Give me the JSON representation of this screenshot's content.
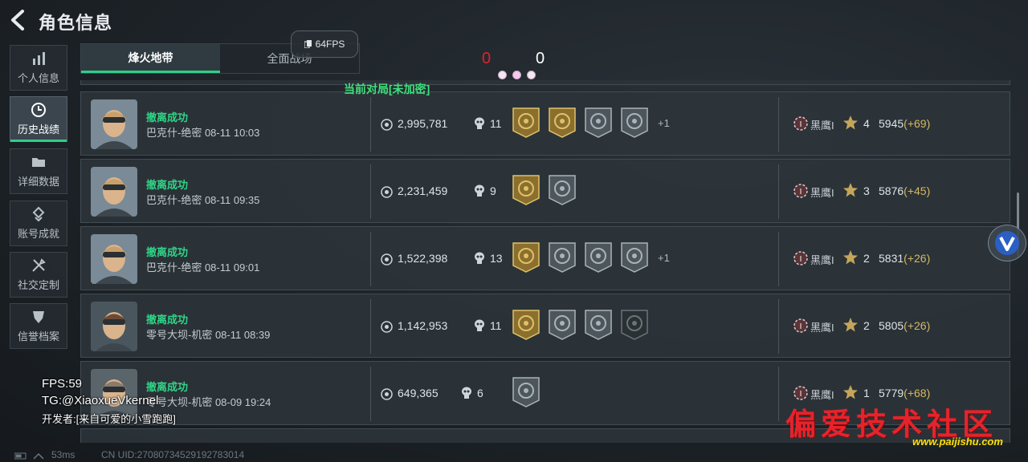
{
  "header": {
    "title": "角色信息"
  },
  "sidebar": {
    "items": [
      {
        "label": "个人信息",
        "icon": "bar-chart-icon"
      },
      {
        "label": "历史战绩",
        "icon": "clock-icon",
        "active": true
      },
      {
        "label": "详细数据",
        "icon": "folder-icon"
      },
      {
        "label": "账号成就",
        "icon": "medal-icon"
      },
      {
        "label": "社交定制",
        "icon": "tools-icon"
      },
      {
        "label": "信誉档案",
        "icon": "shield-icon"
      }
    ]
  },
  "tabs": [
    {
      "label": "烽火地带",
      "active": true
    },
    {
      "label": "全面战场",
      "active": false
    }
  ],
  "fps_pill": "64FPS",
  "score": {
    "left": "0",
    "right": "0",
    "left_color": "#e0222a",
    "right_color": "#ffffff"
  },
  "enc_label": "当前对局[未加密]",
  "matches": [
    {
      "status": "撤离成功",
      "map": "巴克什-绝密 08-11 10:03",
      "money": "2,995,781",
      "kills": "11",
      "badges": [
        "gold",
        "gold",
        "silver",
        "silver"
      ],
      "extra": "+1",
      "rank": "黑鹰I",
      "level": "4",
      "points": "5945",
      "delta": "(+69)"
    },
    {
      "status": "撤离成功",
      "map": "巴克什-绝密 08-11 09:35",
      "money": "2,231,459",
      "kills": "9",
      "badges": [
        "gold",
        "silver"
      ],
      "extra": "",
      "rank": "黑鹰I",
      "level": "3",
      "points": "5876",
      "delta": "(+45)"
    },
    {
      "status": "撤离成功",
      "map": "巴克什-绝密 08-11 09:01",
      "money": "1,522,398",
      "kills": "13",
      "badges": [
        "gold",
        "silver",
        "silver",
        "silver"
      ],
      "extra": "+1",
      "rank": "黑鹰I",
      "level": "2",
      "points": "5831",
      "delta": "(+26)"
    },
    {
      "status": "撤离成功",
      "map": "零号大坝-机密 08-11 08:39",
      "money": "1,142,953",
      "kills": "11",
      "badges": [
        "gold",
        "silver",
        "silver",
        "dark"
      ],
      "extra": "",
      "rank": "黑鹰I",
      "level": "2",
      "points": "5805",
      "delta": "(+26)"
    },
    {
      "status": "撤离成功",
      "map": "零号大坝-机密 08-09 19:24",
      "money": "649,365",
      "kills": "6",
      "badges": [
        "silver"
      ],
      "extra": "",
      "rank": "黑鹰I",
      "level": "1",
      "points": "5779",
      "delta": "(+68)"
    }
  ],
  "overlay": {
    "fps": "FPS:59",
    "tg": "TG:@XiaoxueVkernel",
    "dev": "开发者:[来自可爱的小雪跑跑]"
  },
  "footer": {
    "ping": "53ms",
    "uid": "CN UID:270807345291927830​14"
  },
  "watermark": {
    "logo": "偏爱技术社区",
    "url": "www.paijishu.com"
  },
  "colors": {
    "accent": "#2ecf88",
    "gold_delta": "#d7b760"
  }
}
